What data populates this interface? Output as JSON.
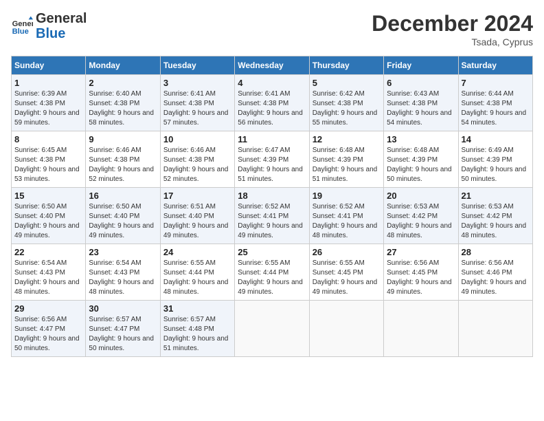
{
  "header": {
    "logo_general": "General",
    "logo_blue": "Blue",
    "month_title": "December 2024",
    "location": "Tsada, Cyprus"
  },
  "days_of_week": [
    "Sunday",
    "Monday",
    "Tuesday",
    "Wednesday",
    "Thursday",
    "Friday",
    "Saturday"
  ],
  "weeks": [
    [
      {
        "day": "1",
        "sunrise": "6:39 AM",
        "sunset": "4:38 PM",
        "daylight": "9 hours and 59 minutes."
      },
      {
        "day": "2",
        "sunrise": "6:40 AM",
        "sunset": "4:38 PM",
        "daylight": "9 hours and 58 minutes."
      },
      {
        "day": "3",
        "sunrise": "6:41 AM",
        "sunset": "4:38 PM",
        "daylight": "9 hours and 57 minutes."
      },
      {
        "day": "4",
        "sunrise": "6:41 AM",
        "sunset": "4:38 PM",
        "daylight": "9 hours and 56 minutes."
      },
      {
        "day": "5",
        "sunrise": "6:42 AM",
        "sunset": "4:38 PM",
        "daylight": "9 hours and 55 minutes."
      },
      {
        "day": "6",
        "sunrise": "6:43 AM",
        "sunset": "4:38 PM",
        "daylight": "9 hours and 54 minutes."
      },
      {
        "day": "7",
        "sunrise": "6:44 AM",
        "sunset": "4:38 PM",
        "daylight": "9 hours and 54 minutes."
      }
    ],
    [
      {
        "day": "8",
        "sunrise": "6:45 AM",
        "sunset": "4:38 PM",
        "daylight": "9 hours and 53 minutes."
      },
      {
        "day": "9",
        "sunrise": "6:46 AM",
        "sunset": "4:38 PM",
        "daylight": "9 hours and 52 minutes."
      },
      {
        "day": "10",
        "sunrise": "6:46 AM",
        "sunset": "4:38 PM",
        "daylight": "9 hours and 52 minutes."
      },
      {
        "day": "11",
        "sunrise": "6:47 AM",
        "sunset": "4:39 PM",
        "daylight": "9 hours and 51 minutes."
      },
      {
        "day": "12",
        "sunrise": "6:48 AM",
        "sunset": "4:39 PM",
        "daylight": "9 hours and 51 minutes."
      },
      {
        "day": "13",
        "sunrise": "6:48 AM",
        "sunset": "4:39 PM",
        "daylight": "9 hours and 50 minutes."
      },
      {
        "day": "14",
        "sunrise": "6:49 AM",
        "sunset": "4:39 PM",
        "daylight": "9 hours and 50 minutes."
      }
    ],
    [
      {
        "day": "15",
        "sunrise": "6:50 AM",
        "sunset": "4:40 PM",
        "daylight": "9 hours and 49 minutes."
      },
      {
        "day": "16",
        "sunrise": "6:50 AM",
        "sunset": "4:40 PM",
        "daylight": "9 hours and 49 minutes."
      },
      {
        "day": "17",
        "sunrise": "6:51 AM",
        "sunset": "4:40 PM",
        "daylight": "9 hours and 49 minutes."
      },
      {
        "day": "18",
        "sunrise": "6:52 AM",
        "sunset": "4:41 PM",
        "daylight": "9 hours and 49 minutes."
      },
      {
        "day": "19",
        "sunrise": "6:52 AM",
        "sunset": "4:41 PM",
        "daylight": "9 hours and 48 minutes."
      },
      {
        "day": "20",
        "sunrise": "6:53 AM",
        "sunset": "4:42 PM",
        "daylight": "9 hours and 48 minutes."
      },
      {
        "day": "21",
        "sunrise": "6:53 AM",
        "sunset": "4:42 PM",
        "daylight": "9 hours and 48 minutes."
      }
    ],
    [
      {
        "day": "22",
        "sunrise": "6:54 AM",
        "sunset": "4:43 PM",
        "daylight": "9 hours and 48 minutes."
      },
      {
        "day": "23",
        "sunrise": "6:54 AM",
        "sunset": "4:43 PM",
        "daylight": "9 hours and 48 minutes."
      },
      {
        "day": "24",
        "sunrise": "6:55 AM",
        "sunset": "4:44 PM",
        "daylight": "9 hours and 48 minutes."
      },
      {
        "day": "25",
        "sunrise": "6:55 AM",
        "sunset": "4:44 PM",
        "daylight": "9 hours and 49 minutes."
      },
      {
        "day": "26",
        "sunrise": "6:55 AM",
        "sunset": "4:45 PM",
        "daylight": "9 hours and 49 minutes."
      },
      {
        "day": "27",
        "sunrise": "6:56 AM",
        "sunset": "4:45 PM",
        "daylight": "9 hours and 49 minutes."
      },
      {
        "day": "28",
        "sunrise": "6:56 AM",
        "sunset": "4:46 PM",
        "daylight": "9 hours and 49 minutes."
      }
    ],
    [
      {
        "day": "29",
        "sunrise": "6:56 AM",
        "sunset": "4:47 PM",
        "daylight": "9 hours and 50 minutes."
      },
      {
        "day": "30",
        "sunrise": "6:57 AM",
        "sunset": "4:47 PM",
        "daylight": "9 hours and 50 minutes."
      },
      {
        "day": "31",
        "sunrise": "6:57 AM",
        "sunset": "4:48 PM",
        "daylight": "9 hours and 51 minutes."
      },
      null,
      null,
      null,
      null
    ]
  ]
}
